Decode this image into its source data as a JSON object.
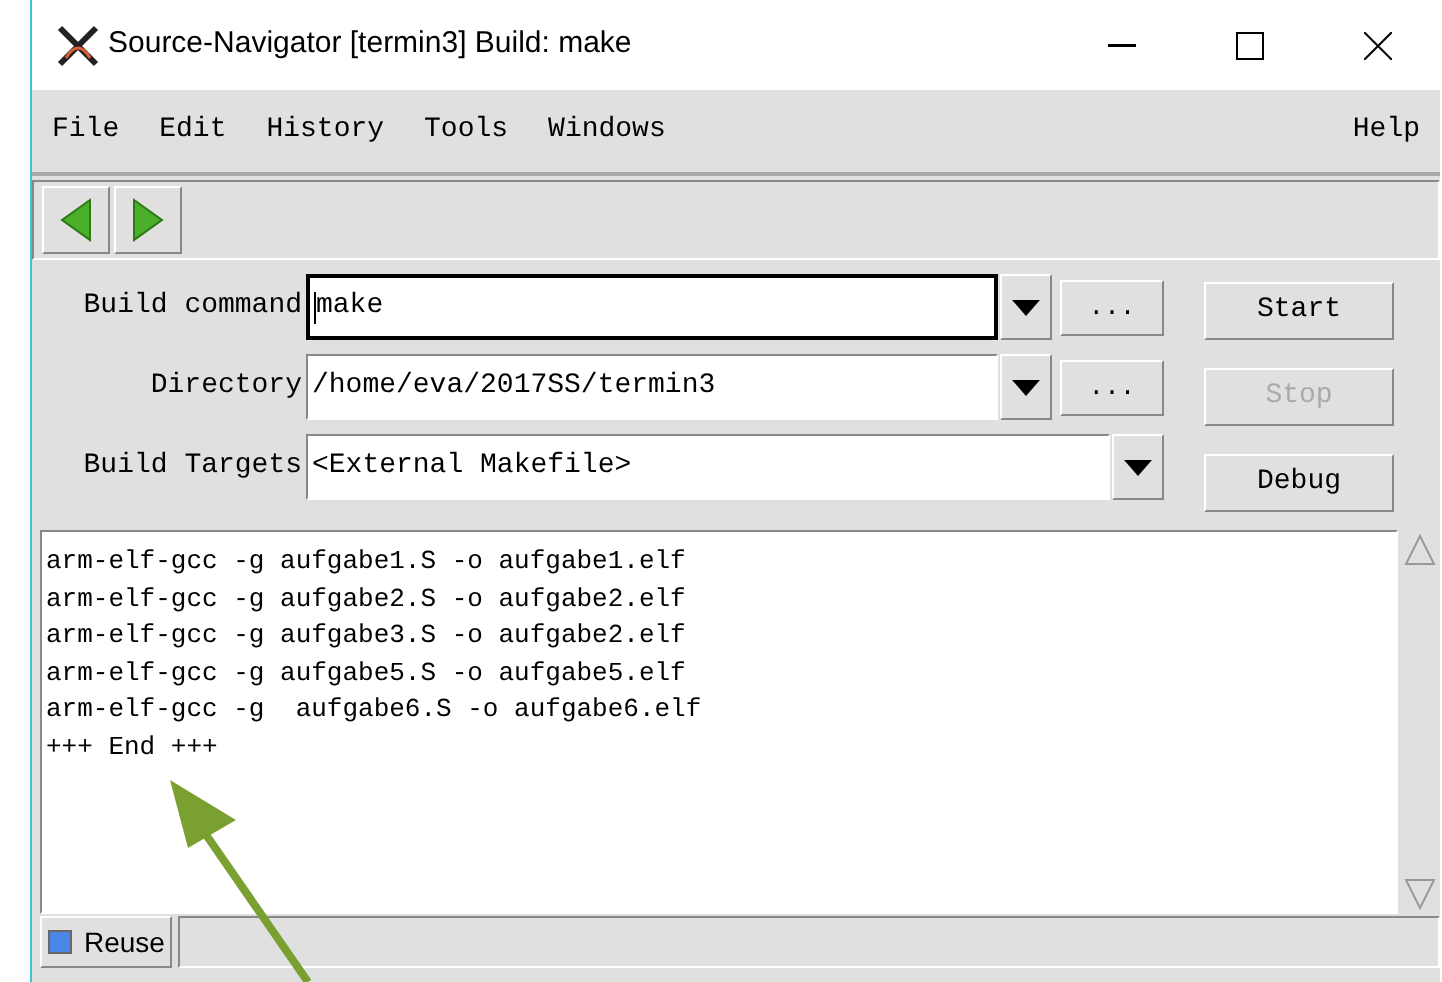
{
  "window": {
    "title": "Source-Navigator [termin3] Build: make"
  },
  "menu": [
    "File",
    "Edit",
    "History",
    "Tools",
    "Windows"
  ],
  "menu_right": "Help",
  "form": {
    "rows": [
      {
        "label": "Build command",
        "value": "make",
        "focused": true,
        "browse": "..."
      },
      {
        "label": "Directory",
        "value": "/home/eva/2017SS/termin3",
        "focused": false,
        "browse": "..."
      },
      {
        "label": "Build Targets",
        "value": "<External Makefile>",
        "focused": false
      }
    ]
  },
  "actions": [
    {
      "label": "Start",
      "disabled": false
    },
    {
      "label": "Stop",
      "disabled": true
    },
    {
      "label": "Debug",
      "disabled": false
    }
  ],
  "output": [
    "arm-elf-gcc -g aufgabe1.S -o aufgabe1.elf",
    "arm-elf-gcc -g aufgabe2.S -o aufgabe2.elf",
    "arm-elf-gcc -g aufgabe3.S -o aufgabe2.elf",
    "arm-elf-gcc -g aufgabe5.S -o aufgabe5.elf",
    "arm-elf-gcc -g  aufgabe6.S -o aufgabe6.elf",
    "+++ End +++"
  ],
  "status_bar": {
    "reuse": {
      "label": "Reuse",
      "checked": true
    }
  }
}
